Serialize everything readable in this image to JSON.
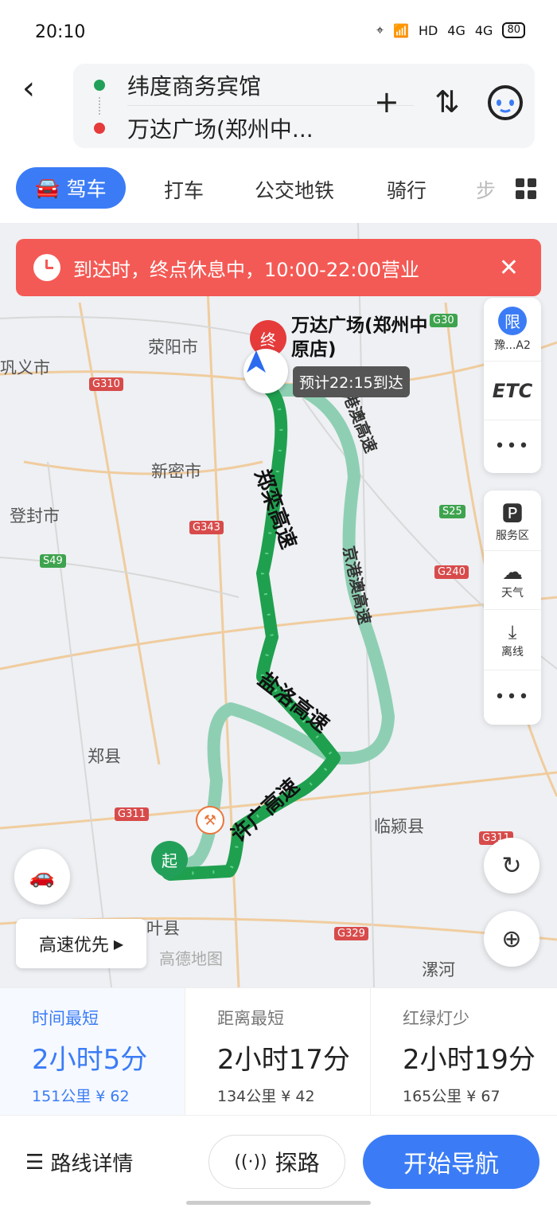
{
  "status_bar": {
    "time": "20:10",
    "network": "HD",
    "signal1": "4G",
    "signal2": "4G",
    "battery": "80"
  },
  "header": {
    "origin": "纬度商务宾馆",
    "destination": "万达广场(郑州中...",
    "add_label": "+",
    "swap_label": "⇅"
  },
  "tabs": {
    "active": "驾车",
    "items": [
      "打车",
      "公交地铁",
      "骑行",
      "步"
    ]
  },
  "banner": {
    "text": "到达时，终点休息中，10:00-22:00营业",
    "close": "✕"
  },
  "map": {
    "cities": [
      "荥阳市",
      "巩义市",
      "新密市",
      "登封市",
      "郑县",
      "叶县",
      "临颍县",
      "漯河"
    ],
    "highways": [
      "G30",
      "G310",
      "S25",
      "G343",
      "S49",
      "G240",
      "G311",
      "G329",
      "G311"
    ],
    "routes": [
      "郑栾高速",
      "盐洛高速",
      "许广高速",
      "京港澳高速",
      "京港澳高速"
    ],
    "dest_marker": "终",
    "dest_name": "万达广场(郑州中原店)",
    "eta": "预计22:15到达",
    "start_marker": "起",
    "highway_pref": "高速优先",
    "watermark": "高德地图"
  },
  "side_tools": {
    "restrict": {
      "badge": "限",
      "label": "豫...A2"
    },
    "etc": "ETC",
    "more": "•••",
    "service": "服务区",
    "weather": "天气",
    "offline": "离线"
  },
  "options": [
    {
      "label": "时间最短",
      "duration": "2小时5分",
      "meta": "151公里 ¥ 62"
    },
    {
      "label": "距离最短",
      "duration": "2小时17分",
      "meta": "134公里 ¥ 42"
    },
    {
      "label": "红绿灯少",
      "duration": "2小时19分",
      "meta": "165公里 ¥ 67"
    }
  ],
  "actions": {
    "details": "路线详情",
    "probe": "探路",
    "start": "开始导航"
  },
  "colors": {
    "accent": "#3b7cf6",
    "route_main": "#1fa04f",
    "route_alt": "#8ecfb3",
    "alert": "#f45a55"
  }
}
